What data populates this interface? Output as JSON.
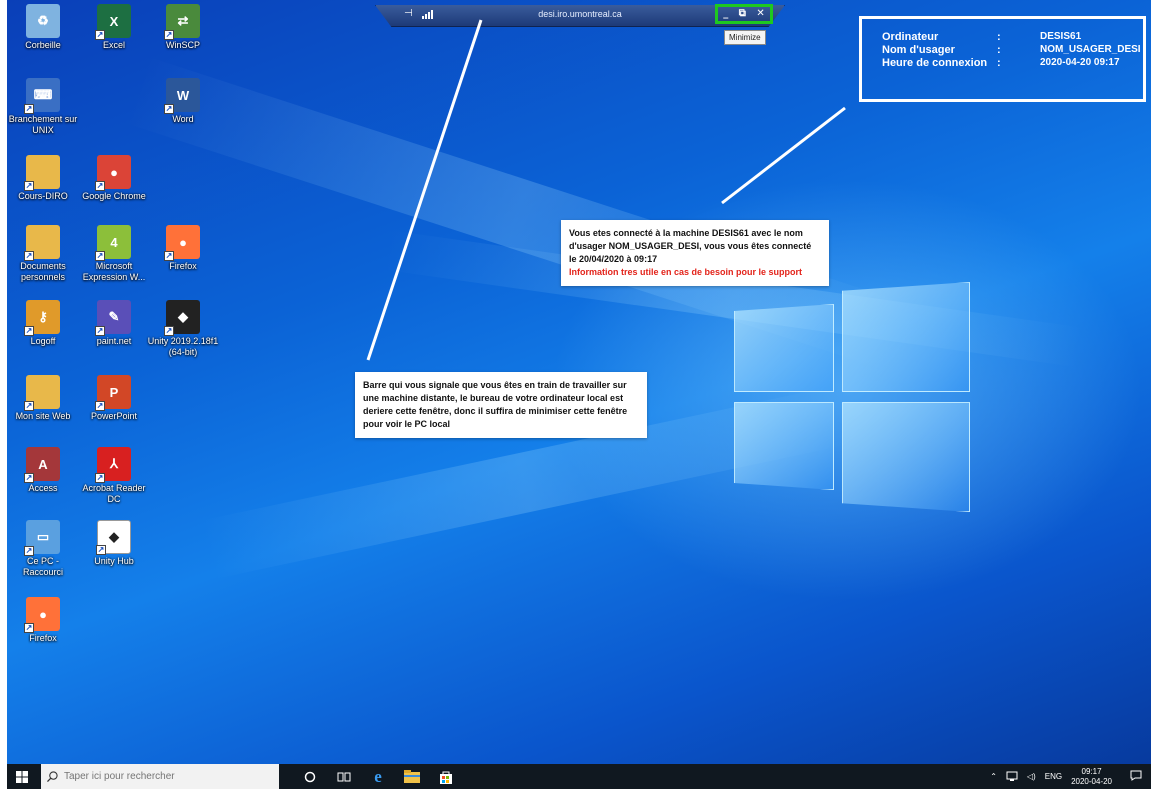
{
  "rdp_bar": {
    "host": "desi.iro.umontreal.ca",
    "tooltip": "Minimize"
  },
  "bginfo": {
    "rows": [
      {
        "key": "Ordinateur",
        "sep": ":",
        "value": "DESIS61"
      },
      {
        "key": "Nom d'usager",
        "sep": ":",
        "value": "NOM_USAGER_DESI"
      },
      {
        "key": "Heure de connexion",
        "sep": ":",
        "value": "2020-04-20 09:17"
      }
    ]
  },
  "notes": {
    "connection": {
      "text": "Vous etes connecté à la machine DESIS61 avec le nom d'usager NOM_USAGER_DESI, vous vous êtes connecté le 20/04/2020 à 09:17",
      "highlight": "Information tres utile en cas de besoin pour le support",
      "highlight_color": "#e3241b"
    },
    "bar": {
      "text": "Barre qui vous signale que vous êtes en train de travailler sur une machine distante, le bureau de votre ordinateur local est deriere cette fenêtre, donc il suffira de minimiser cette fenêtre pour voir le PC local"
    }
  },
  "desktop_icons": [
    {
      "label": "Corbeille",
      "icon": "recycle-bin-icon",
      "color": "#7fb3e0"
    },
    {
      "label": "Excel",
      "icon": "excel-icon",
      "color": "#1d6f42"
    },
    {
      "label": "WinSCP",
      "icon": "winscp-icon",
      "color": "#4a8a3c"
    },
    {
      "label": "Branchement sur UNIX",
      "icon": "network-computer-icon",
      "color": "#3a6fc4"
    },
    {
      "label": "Word",
      "icon": "word-icon",
      "color": "#2b579a"
    },
    {
      "label": "Cours-DIRO",
      "icon": "folder-icon",
      "color": "#e8b84a"
    },
    {
      "label": "Google Chrome",
      "icon": "chrome-icon",
      "color": "#db4437"
    },
    {
      "label": "Documents personnels",
      "icon": "folder-icon",
      "color": "#e8b84a"
    },
    {
      "label": "Microsoft Expression W...",
      "icon": "expression-web-icon",
      "color": "#8cbf3a"
    },
    {
      "label": "Firefox",
      "icon": "firefox-icon",
      "color": "#ff7139"
    },
    {
      "label": "Logoff",
      "icon": "key-icon",
      "color": "#e09a2a"
    },
    {
      "label": "paint.net",
      "icon": "paintnet-icon",
      "color": "#5a4fb8"
    },
    {
      "label": "Unity 2019.2.18f1 (64-bit)",
      "icon": "unity-icon",
      "color": "#222222"
    },
    {
      "label": "Mon site Web",
      "icon": "web-folder-icon",
      "color": "#e8b84a"
    },
    {
      "label": "PowerPoint",
      "icon": "powerpoint-icon",
      "color": "#d24726"
    },
    {
      "label": "Access",
      "icon": "access-icon",
      "color": "#a4373a"
    },
    {
      "label": "Acrobat Reader DC",
      "icon": "acrobat-icon",
      "color": "#d82020"
    },
    {
      "label": "Ce PC - Raccourci",
      "icon": "this-pc-icon",
      "color": "#5aa0e0"
    },
    {
      "label": "Unity Hub",
      "icon": "unity-hub-icon",
      "color": "#ffffff"
    },
    {
      "label": "Firefox",
      "icon": "firefox-icon",
      "color": "#ff7139"
    }
  ],
  "taskbar": {
    "search_placeholder": "Taper ici pour rechercher",
    "lang": "ENG",
    "time": "09:17",
    "date": "2020-04-20"
  }
}
